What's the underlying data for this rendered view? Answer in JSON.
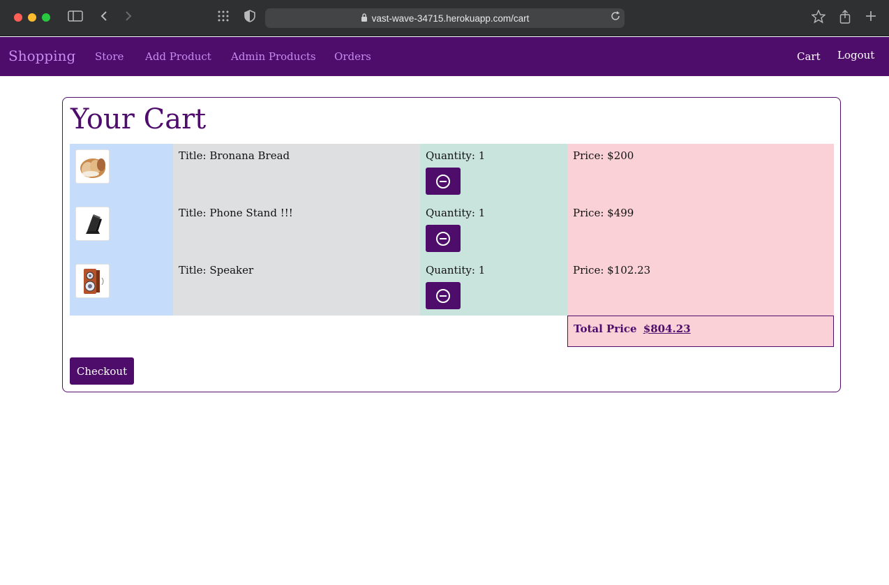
{
  "browser": {
    "url": "vast-wave-34715.herokuapp.com/cart"
  },
  "navbar": {
    "brand": "Shopping",
    "links": [
      "Store",
      "Add Product",
      "Admin Products",
      "Orders"
    ],
    "right": [
      "Cart",
      "Logout"
    ]
  },
  "page": {
    "title": "Your Cart"
  },
  "cart": {
    "items": [
      {
        "image": "bread-image",
        "title": "Title: Bronana Bread",
        "quantity": "Quantity: 1",
        "price": "Price: $200"
      },
      {
        "image": "phone-stand-image",
        "title": "Title: Phone Stand !!!",
        "quantity": "Quantity: 1",
        "price": "Price: $499"
      },
      {
        "image": "speaker-image",
        "title": "Title: Speaker",
        "quantity": "Quantity: 1",
        "price": "Price: $102.23"
      }
    ],
    "total_label": "Total Price",
    "total_value": "$804.23",
    "checkout_label": "Checkout"
  },
  "colors": {
    "brand_purple": "#4e0d6b",
    "nav_link": "#c58bf0",
    "col_image": "#c6dcfb",
    "col_title": "#dedfe1",
    "col_qty": "#c8e4dc",
    "col_price": "#f9d1d6"
  }
}
